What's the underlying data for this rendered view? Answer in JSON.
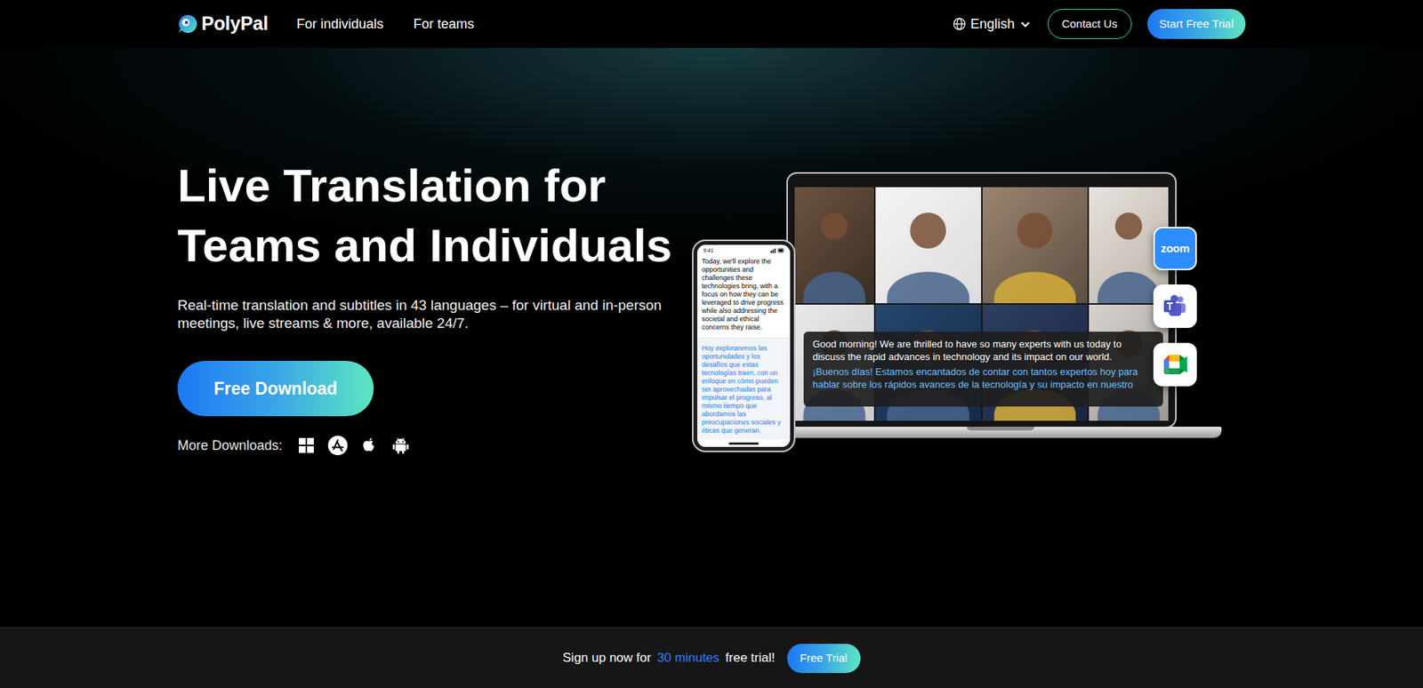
{
  "nav": {
    "brand": "PolyPal",
    "links": [
      {
        "label": "For individuals"
      },
      {
        "label": "For teams"
      }
    ],
    "language": "English",
    "contact": "Contact Us",
    "trial": "Start Free Trial"
  },
  "hero": {
    "title": "Live Translation for Teams and Individuals",
    "subtitle": "Real-time translation and subtitles in 43 languages – for virtual and in-person meetings, live streams & more, available 24/7.",
    "download": "Free Download",
    "more_downloads": "More Downloads:"
  },
  "illustration": {
    "phone": {
      "time": "9:41",
      "source": "Today, we'll explore the opportunities and challenges these technologies bring, with a focus on how they can be leveraged to drive progress while also addressing the societal and ethical concerns they raise.",
      "translation": "Hoy exploraremos las oportunidades y los desafíos que estas tecnologías traen, con un enfoque en cómo pueden ser aprovechadas para impulsar el progreso, al mismo tiempo que abordamos las preocupaciones sociales y éticas que generan."
    },
    "caption": {
      "source": "Good morning! We are thrilled to have so many experts with us today to discuss the rapid advances in technology and its impact on our world.",
      "translation": "¡Buenos días! Estamos encantados de contar con tantos expertos hoy para hablar sobre los rápidos avances de la tecnología y su impacto en nuestro"
    },
    "zoom_label": "zoom"
  },
  "banner": {
    "before": "Sign up now for",
    "highlight": "30 minutes",
    "after": "free trial!",
    "button": "Free Trial"
  }
}
